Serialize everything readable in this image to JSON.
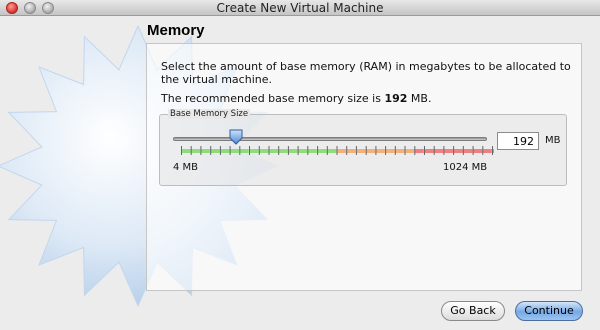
{
  "window": {
    "title": "Create New Virtual Machine"
  },
  "page": {
    "heading": "Memory",
    "description": "Select the amount of base memory (RAM) in megabytes to be allocated to the virtual machine.",
    "recommended_prefix": "The recommended base memory size is ",
    "recommended_value": "192",
    "recommended_suffix": " MB."
  },
  "memory": {
    "group_label": "Base Memory Size",
    "value": "192",
    "unit": "MB",
    "min_label": "4 MB",
    "max_label": "1024 MB",
    "min": 4,
    "max": 1024,
    "current": 192
  },
  "buttons": {
    "back": "Go Back",
    "continue": "Continue"
  },
  "colors": {
    "green_zone": "#8fdc7a",
    "orange_zone": "#f2b07a",
    "red_zone": "#f07f82"
  }
}
